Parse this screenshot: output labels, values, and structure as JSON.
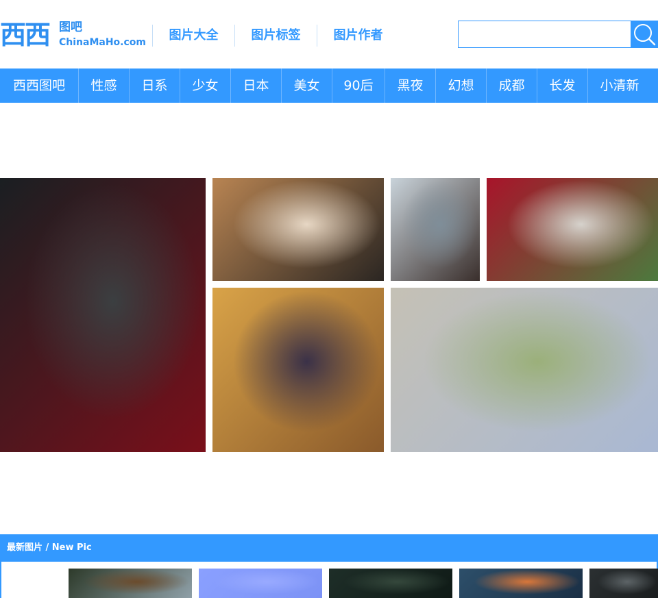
{
  "logo": {
    "big": "西西",
    "small": "图吧",
    "domain": "ChinaMaHo.com"
  },
  "topnav": [
    "图片大全",
    "图片标签",
    "图片作者"
  ],
  "search": {
    "value": "",
    "icon": "search-icon"
  },
  "categories": [
    "西西图吧",
    "性感",
    "日系",
    "少女",
    "日本",
    "美女",
    "90后",
    "黑夜",
    "幻想",
    "成都",
    "长发",
    "小清新"
  ],
  "featured": [
    {
      "name": "photo-red-hood",
      "colors": [
        "#1a1f22",
        "#3b3f41",
        "#7a0f1a"
      ]
    },
    {
      "name": "photo-sleeping-sweater",
      "colors": [
        "#b88452",
        "#e7d7c4",
        "#2b2622"
      ]
    },
    {
      "name": "photo-knit-hat",
      "colors": [
        "#c9d3da",
        "#7f8e99",
        "#3a2f2c"
      ]
    },
    {
      "name": "photo-red-umbrella",
      "colors": [
        "#a8142a",
        "#d6d2cc",
        "#4c7a3e"
      ]
    },
    {
      "name": "photo-kimono-sleeping",
      "colors": [
        "#d9a348",
        "#3a3148",
        "#8a5a2b"
      ]
    },
    {
      "name": "photo-bridge-girl",
      "colors": [
        "#c5c1b5",
        "#9bb07a",
        "#a9b8d3"
      ]
    }
  ],
  "newpic": {
    "title": "最新图片 / New Pic"
  },
  "thumbs": [
    {
      "name": "thumb-waterfall",
      "colors": [
        "#2d3a2a",
        "#6b4b2c",
        "#8fa0a8"
      ]
    },
    {
      "name": "thumb-blue-sky",
      "colors": [
        "#8aa0ff",
        "#99aaff",
        "#7c92f5"
      ]
    },
    {
      "name": "thumb-dark-leaf",
      "colors": [
        "#1e2e28",
        "#35483c",
        "#0f1a16"
      ]
    },
    {
      "name": "thumb-sunset-clouds",
      "colors": [
        "#2d4f6a",
        "#d9773a",
        "#1a2f45"
      ]
    },
    {
      "name": "thumb-dark-window",
      "colors": [
        "#2b3032",
        "#5d6467",
        "#1a1d1e"
      ]
    }
  ]
}
